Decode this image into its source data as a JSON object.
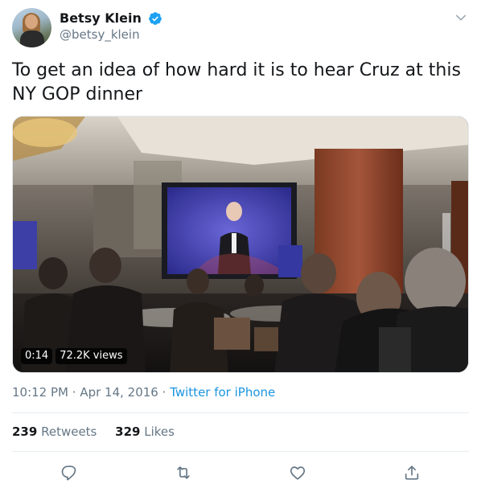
{
  "author": {
    "display_name": "Betsy Klein",
    "handle": "@betsy_klein",
    "avatar_icon": "avatar",
    "verified_icon": "verified-badge-icon"
  },
  "tweet": {
    "text": "To get an idea of how hard it is to hear Cruz at this NY GOP dinner"
  },
  "video": {
    "duration": "0:14",
    "views": "72.2K views"
  },
  "meta": {
    "time": "10:12 PM",
    "separator": "·",
    "date": "Apr 14, 2016",
    "source": "Twitter for iPhone"
  },
  "stats": {
    "retweets_count": "239",
    "retweets_label": "Retweets",
    "likes_count": "329",
    "likes_label": "Likes"
  },
  "actions": [
    "reply-icon",
    "retweet-icon",
    "like-icon",
    "share-icon"
  ],
  "colors": {
    "text": "#14171a",
    "secondary": "#657786",
    "link": "#1b95e0",
    "verified": "#1da1f2",
    "divider": "#e6ecf0"
  }
}
